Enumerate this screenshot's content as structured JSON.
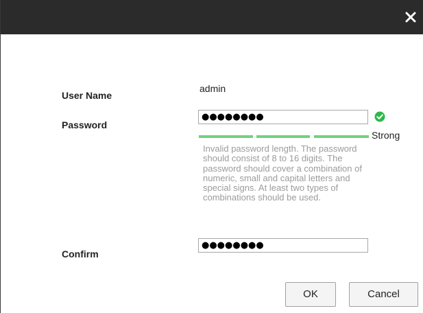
{
  "dialog": {
    "close_icon": "close-icon"
  },
  "fields": {
    "user_name_label": "User Name",
    "user_name_value": "admin",
    "password_label": "Password",
    "password_value": "●●●●●●●●",
    "confirm_label": "Confirm",
    "confirm_value": "●●●●●●●●"
  },
  "strength": {
    "label": "Strong",
    "level": 3,
    "max_level": 3,
    "color": "#6fd47b",
    "valid_icon": "check-circle-icon",
    "valid_color": "#2fb84a"
  },
  "hint": "Invalid password length. The password should consist of 8 to 16 digits. The password should cover a combination of numeric, small and capital letters and special signs. At least two types of combinations should be used.",
  "buttons": {
    "ok": "OK",
    "cancel": "Cancel"
  }
}
